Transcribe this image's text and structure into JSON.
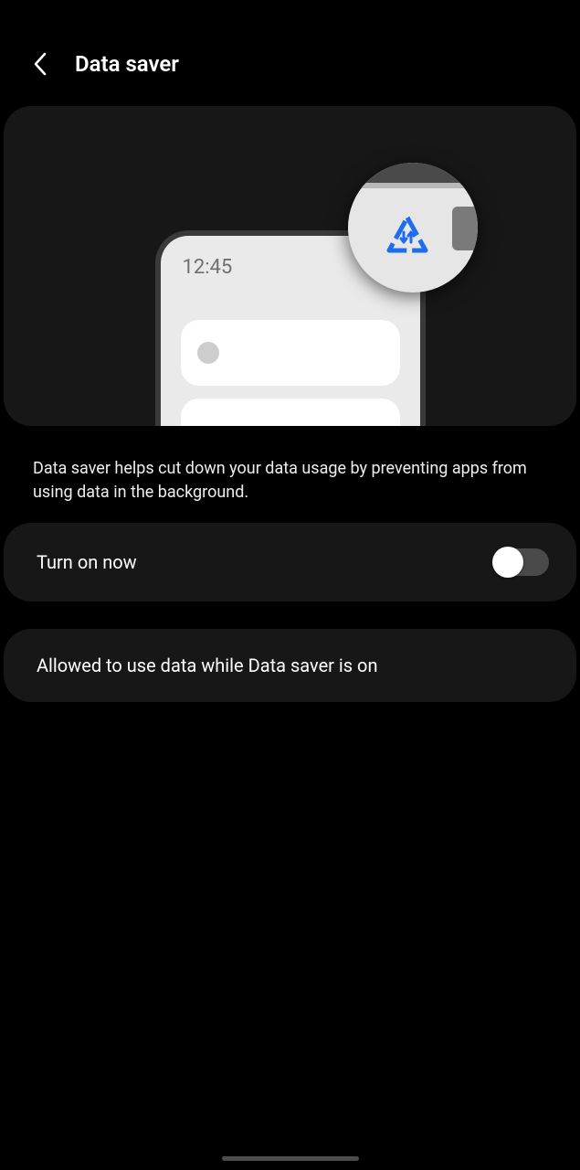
{
  "header": {
    "title": "Data saver"
  },
  "illustration": {
    "clock": "12:45"
  },
  "description": "Data saver helps cut down your data usage by preventing apps from using data in the background.",
  "rows": {
    "turn_on": {
      "label": "Turn on now",
      "enabled": false
    },
    "allowed": {
      "label": "Allowed to use data while Data saver is on"
    }
  }
}
